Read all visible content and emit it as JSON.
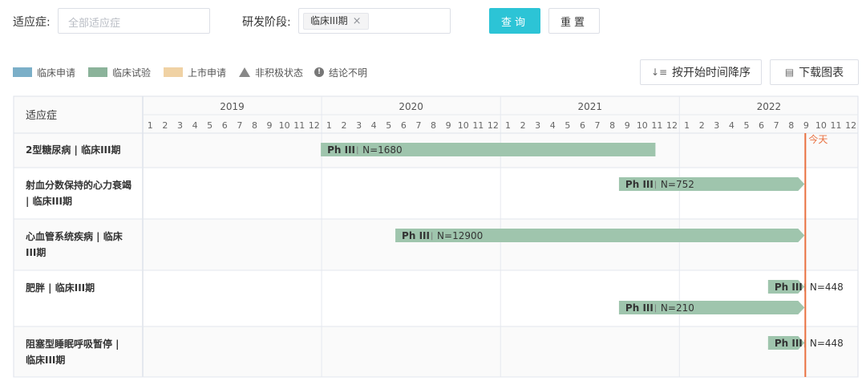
{
  "filters": {
    "indication_label": "适应症:",
    "indication_placeholder": "全部适应症",
    "stage_label": "研发阶段:",
    "stage_tag": "临床III期",
    "stage_tag_close": "×",
    "query_button": "查询",
    "reset_button": "重置"
  },
  "legend": [
    {
      "label": "临床申请",
      "color": "#7bafc8",
      "shape": "swatch"
    },
    {
      "label": "临床试验",
      "color": "#8bb39a",
      "shape": "swatch"
    },
    {
      "label": "上市申请",
      "color": "#f0d2a4",
      "shape": "swatch"
    },
    {
      "label": "非积极状态",
      "color": "#888888",
      "shape": "triangle"
    },
    {
      "label": "结论不明",
      "color": "#777777",
      "shape": "circle",
      "glyph": "!"
    }
  ],
  "toolbar": {
    "sort_button": "按开始时间降序",
    "download_button": "下载图表"
  },
  "table": {
    "header_label": "适应症",
    "years": [
      "2019",
      "2020",
      "2021",
      "2022"
    ],
    "months": [
      "1",
      "2",
      "3",
      "4",
      "5",
      "6",
      "7",
      "8",
      "9",
      "10",
      "11",
      "12"
    ],
    "today_label": "今天",
    "rows": [
      {
        "label": "2型糖尿病 | 临床III期"
      },
      {
        "label": "射血分数保持的心力衰竭 | 临床III期"
      },
      {
        "label": "心血管系统疾病 | 临床III期"
      },
      {
        "label": "肥胖 | 临床III期"
      },
      {
        "label": "阻塞型睡眠呼吸暂停 | 临床III期"
      }
    ]
  },
  "colors": {
    "bar": "#9fc5ad",
    "bar_text": "#333333",
    "today_line": "#e9703f",
    "grid": "#e6e9ef",
    "row_alt": "#fafafa"
  },
  "chart_data": {
    "type": "gantt",
    "x_range": [
      "2019-01",
      "2022-12"
    ],
    "today": "2022-09",
    "bars": [
      {
        "row": 0,
        "phase": "Ph III",
        "n_label": "N=1680",
        "start": "2020-01",
        "end": "2021-11",
        "arrow": false
      },
      {
        "row": 1,
        "phase": "Ph III",
        "n_label": "N=752",
        "start": "2021-09",
        "end": "2022-09",
        "arrow": true
      },
      {
        "row": 2,
        "phase": "Ph III",
        "n_label": "N=12900",
        "start": "2020-06",
        "end": "2022-09",
        "arrow": true
      },
      {
        "row": 3,
        "phase": "Ph III",
        "n_label": "N=448",
        "start": "2022-07",
        "end": "2022-09",
        "arrow": true
      },
      {
        "row": 3,
        "phase": "Ph III",
        "n_label": "N=210",
        "start": "2021-09",
        "end": "2022-09",
        "arrow": true
      },
      {
        "row": 4,
        "phase": "Ph III",
        "n_label": "N=448",
        "start": "2022-07",
        "end": "2022-09",
        "arrow": true
      }
    ]
  }
}
